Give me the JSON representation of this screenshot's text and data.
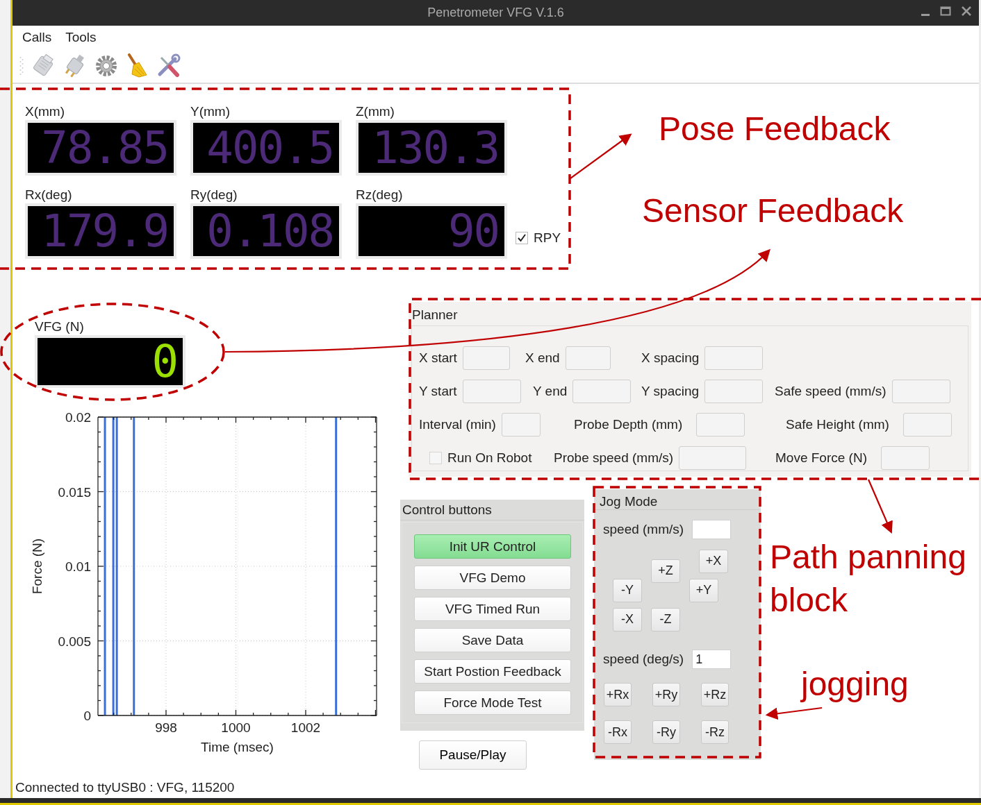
{
  "window": {
    "title": "Penetrometer VFG V.1.6"
  },
  "menu": [
    "Calls",
    "Tools"
  ],
  "pose": {
    "readouts": [
      {
        "label": "X(mm)",
        "value": "78.85"
      },
      {
        "label": "Y(mm)",
        "value": "400.5"
      },
      {
        "label": "Z(mm)",
        "value": "130.3"
      },
      {
        "label": "Rx(deg)",
        "value": "179.9"
      },
      {
        "label": "Ry(deg)",
        "value": "0.108"
      },
      {
        "label": "Rz(deg)",
        "value": "90"
      }
    ],
    "rpy": {
      "label": "RPY",
      "checked": true
    }
  },
  "sensor": {
    "label": "VFG (N)",
    "value": "0"
  },
  "force_plot": {
    "chart_data": {
      "type": "line",
      "xlabel": "Time (msec)",
      "ylabel": "Force (N)",
      "xlim": [
        996.05,
        1004.03
      ],
      "ylim": [
        0,
        0.02
      ],
      "xticks": [
        998,
        1000,
        1002
      ],
      "yticks": [
        0,
        0.005,
        0.01,
        0.015,
        0.02
      ],
      "grid": true,
      "ref_lines": [
        {
          "axis": "x",
          "value": 996.25
        },
        {
          "axis": "x",
          "value": 996.49
        },
        {
          "axis": "x",
          "value": 996.59
        },
        {
          "axis": "x",
          "value": 997.08
        },
        {
          "axis": "x",
          "value": 1002.87
        }
      ]
    }
  },
  "planner": {
    "title": "Planner",
    "rows": [
      [
        {
          "kind": "field",
          "label": "X start"
        },
        {
          "kind": "field",
          "label": "X end"
        },
        {
          "kind": "field",
          "label": "X spacing"
        }
      ],
      [
        {
          "kind": "field",
          "label": "Y start"
        },
        {
          "kind": "field",
          "label": "Y end"
        },
        {
          "kind": "field",
          "label": "Y spacing"
        },
        {
          "kind": "field",
          "label": "Safe speed (mm/s)"
        }
      ],
      [
        {
          "kind": "field",
          "label": "Interval (min)"
        },
        {
          "kind": "field",
          "label": "Probe Depth (mm)"
        },
        {
          "kind": "field",
          "label": "Safe Height (mm)"
        }
      ],
      [
        {
          "kind": "checkbox",
          "label": "Run On Robot",
          "checked": false
        },
        {
          "kind": "field",
          "label": "Probe speed (mm/s)"
        },
        {
          "kind": "field",
          "label": "Move Force (N)"
        }
      ]
    ]
  },
  "controls": {
    "title": "Control buttons",
    "buttons": [
      {
        "label": "Init UR Control",
        "active": true
      },
      {
        "label": "VFG Demo",
        "active": false
      },
      {
        "label": "VFG Timed Run",
        "active": false
      },
      {
        "label": "Save Data",
        "active": false
      },
      {
        "label": "Start Postion Feedback",
        "active": false
      },
      {
        "label": "Force Mode Test",
        "active": false
      }
    ]
  },
  "pause_button": "Pause/Play",
  "jog": {
    "title": "Jog Mode",
    "linear_speed": {
      "label": "speed (mm/s)"
    },
    "linear_buttons": [
      "+X",
      "+Z",
      "-Y",
      "+Y",
      "-X",
      "-Z"
    ],
    "angular_speed": {
      "label": "speed (deg/s)",
      "value": "1"
    },
    "angular_buttons": [
      "+Rx",
      "+Ry",
      "+Rz",
      "-Rx",
      "-Ry",
      "-Rz"
    ]
  },
  "status_bar": "Connected to ttyUSB0 : VFG, 115200",
  "annotations": [
    {
      "text": "Pose Feedback"
    },
    {
      "text": "Sensor Feedback"
    },
    {
      "text": "Path panning block"
    },
    {
      "text": "jogging"
    }
  ]
}
